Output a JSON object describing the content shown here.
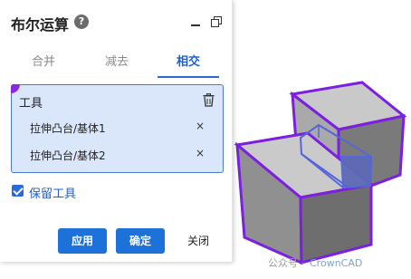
{
  "panel": {
    "title": "布尔运算",
    "help_icon": "?",
    "minimize_icon": "minimize",
    "restore_icon": "restore-window"
  },
  "tabs": [
    {
      "label": "合并",
      "active": false
    },
    {
      "label": "减去",
      "active": false
    },
    {
      "label": "相交",
      "active": true
    }
  ],
  "tools": {
    "header": "工具",
    "delete_icon": "trash-icon",
    "items": [
      {
        "label": "拉伸凸台/基体1",
        "remove": "×"
      },
      {
        "label": "拉伸凸台/基体2",
        "remove": "×"
      }
    ]
  },
  "keep_tools": {
    "label": "保留工具",
    "checked": true
  },
  "buttons": {
    "apply": "应用",
    "confirm": "确定",
    "close": "关闭"
  },
  "watermark": {
    "prefix": "公众号 ·",
    "brand": "CrownCAD"
  },
  "colors": {
    "accent": "#1c72d8",
    "selection_outline": "#7b1fe0",
    "intersection_outline": "#5566dd",
    "tools_box_fill": "#dae7fb"
  }
}
